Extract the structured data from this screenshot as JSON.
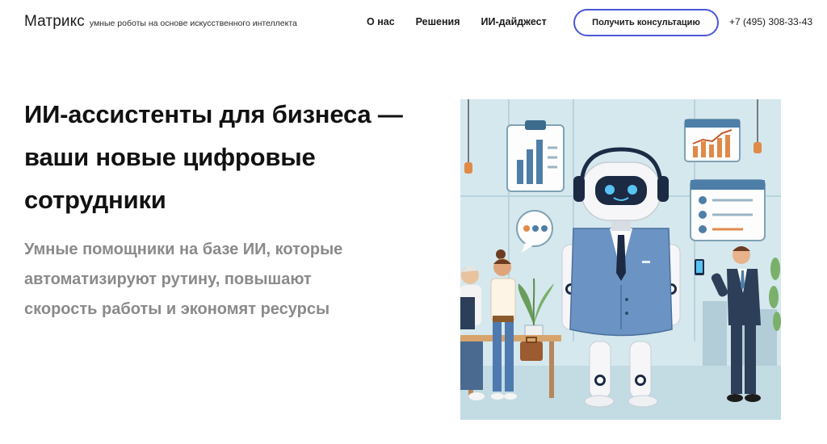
{
  "header": {
    "logo": {
      "name": "Матрикс",
      "tagline": "умные роботы на основе искусственного интеллекта"
    },
    "nav": [
      {
        "label": "О нас"
      },
      {
        "label": "Решения"
      },
      {
        "label": "ИИ-дайджест"
      }
    ],
    "cta_label": "Получить консультацию",
    "phone": "+7 (495) 308-33-43"
  },
  "hero": {
    "title": "ИИ-ассистенты для бизнеса — ваши новые цифровые сотрудники",
    "subtitle": "Умные помощники на базе ИИ, которые автоматизируют рутину, повышают скорость работы и экономят ресурсы"
  },
  "colors": {
    "cta_border": "#4a57d6",
    "subtitle": "#8a8a8a",
    "illustration_bg": "#cfe3ea"
  }
}
